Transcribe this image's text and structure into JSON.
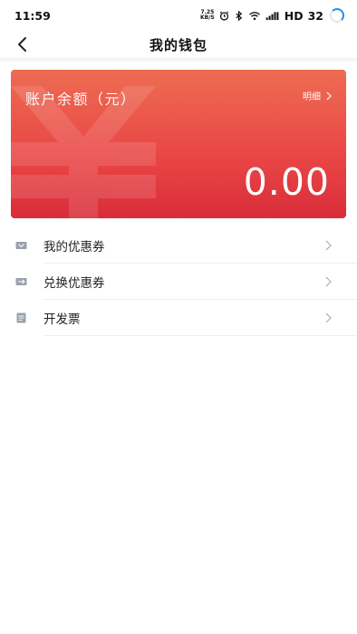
{
  "status_bar": {
    "time": "11:59",
    "net_speed_value": "7.25",
    "net_speed_unit": "KB/S",
    "signal_label": "HD",
    "battery": "32",
    "icons": [
      "alarm-icon",
      "bluetooth-icon",
      "wifi-icon",
      "signal-icon",
      "battery-ring-icon"
    ]
  },
  "nav": {
    "title": "我的钱包",
    "back_icon": "chevron-left-icon"
  },
  "wallet_card": {
    "title": "账户余额（元）",
    "detail_label": "明细",
    "amount": "0.00",
    "watermark_icon": "yuan-icon",
    "gradient_colors": [
      "#ee6c52",
      "#e94545",
      "#d92d3a"
    ]
  },
  "menu": {
    "items": [
      {
        "label": "我的优惠券",
        "icon": "coupon-icon"
      },
      {
        "label": "兑换优惠券",
        "icon": "coupon-exchange-icon"
      },
      {
        "label": "开发票",
        "icon": "invoice-icon"
      }
    ],
    "arrow_icon": "chevron-right-icon"
  }
}
